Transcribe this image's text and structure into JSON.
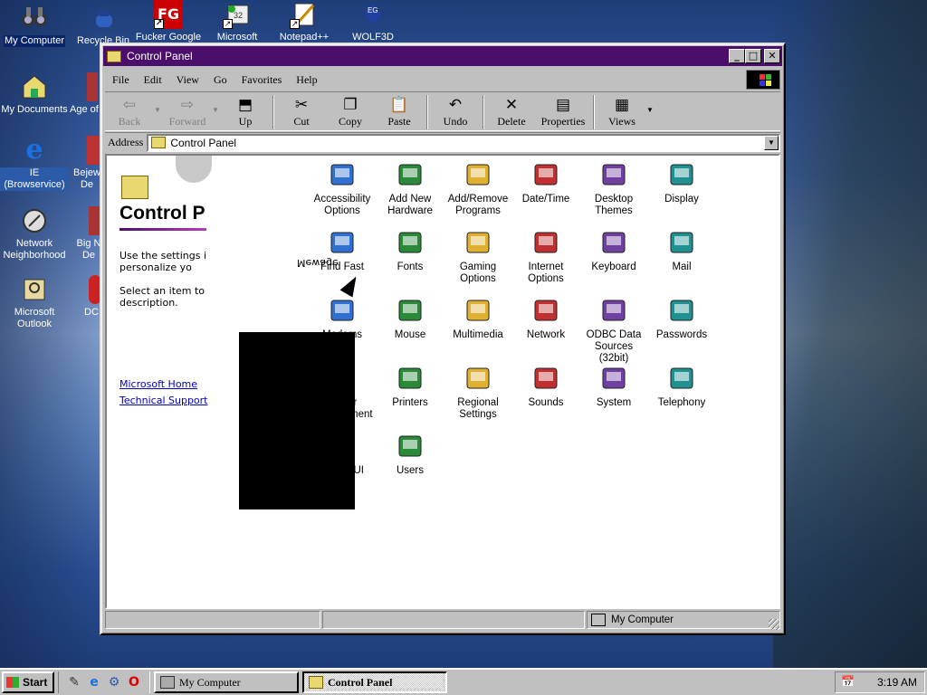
{
  "desktop": {
    "icons": [
      {
        "label": "My Computer",
        "icon": "my-computer-icon"
      },
      {
        "label": "Recycle Bin",
        "icon": "recycle-bin-icon"
      },
      {
        "label": "Fucker Google",
        "icon": "fg-icon"
      },
      {
        "label": "Microsoft",
        "icon": "microsoft-32-icon"
      },
      {
        "label": "Notepad++",
        "icon": "notepad-plus-icon"
      },
      {
        "label": "WOLF3D",
        "icon": "wolf3d-icon"
      },
      {
        "label": "My Documents",
        "icon": "my-documents-icon"
      },
      {
        "label": "Age of",
        "icon": "age-of-icon"
      },
      {
        "label": "IE (Browservice)",
        "icon": "internet-explorer-icon"
      },
      {
        "label": "Bejew De",
        "icon": "bejeweled-icon"
      },
      {
        "label": "Network Neighborhood",
        "icon": "network-neighborhood-icon"
      },
      {
        "label": "Big N De",
        "icon": "big-n-icon"
      },
      {
        "label": "Microsoft Outlook",
        "icon": "outlook-icon"
      },
      {
        "label": "DC",
        "icon": "dc-icon"
      }
    ]
  },
  "window": {
    "title": "Control Panel",
    "menu": [
      "File",
      "Edit",
      "View",
      "Go",
      "Favorites",
      "Help"
    ],
    "toolbar": {
      "back": "Back",
      "forward": "Forward",
      "up": "Up",
      "cut": "Cut",
      "copy": "Copy",
      "paste": "Paste",
      "undo": "Undo",
      "delete": "Delete",
      "properties": "Properties",
      "views": "Views"
    },
    "address": {
      "label": "Address",
      "value": "Control Panel"
    },
    "leftpane": {
      "heading": "Control P",
      "desc1": "Use the settings in Control Panel to personalize yo",
      "desc2": "Select an item to view its description.",
      "link1": "Microsoft Home",
      "link2": "Technical Support",
      "mirror_text": "Mewage"
    },
    "items": [
      {
        "label": "Accessibility Options",
        "icon": "accessibility-icon"
      },
      {
        "label": "Add New Hardware",
        "icon": "add-hardware-icon"
      },
      {
        "label": "Add/Remove Programs",
        "icon": "add-remove-programs-icon"
      },
      {
        "label": "Date/Time",
        "icon": "date-time-icon"
      },
      {
        "label": "Desktop Themes",
        "icon": "desktop-themes-icon"
      },
      {
        "label": "Display",
        "icon": "display-icon"
      },
      {
        "label": "Find Fast",
        "icon": "find-fast-icon"
      },
      {
        "label": "Fonts",
        "icon": "fonts-icon"
      },
      {
        "label": "Gaming Options",
        "icon": "gaming-options-icon"
      },
      {
        "label": "Internet Options",
        "icon": "internet-options-icon"
      },
      {
        "label": "Keyboard",
        "icon": "keyboard-icon"
      },
      {
        "label": "Mail",
        "icon": "mail-icon"
      },
      {
        "label": "Modems",
        "icon": "modems-icon"
      },
      {
        "label": "Mouse",
        "icon": "mouse-icon"
      },
      {
        "label": "Multimedia",
        "icon": "multimedia-icon"
      },
      {
        "label": "Network",
        "icon": "network-icon"
      },
      {
        "label": "ODBC Data Sources (32bit)",
        "icon": "odbc-icon"
      },
      {
        "label": "Passwords",
        "icon": "passwords-icon"
      },
      {
        "label": "Power Management",
        "icon": "power-management-icon"
      },
      {
        "label": "Printers",
        "icon": "printers-icon"
      },
      {
        "label": "Regional Settings",
        "icon": "regional-settings-icon"
      },
      {
        "label": "Sounds",
        "icon": "sounds-icon"
      },
      {
        "label": "System",
        "icon": "system-icon"
      },
      {
        "label": "Telephony",
        "icon": "telephony-icon"
      },
      {
        "label": "Tweak UI",
        "icon": "tweak-ui-icon"
      },
      {
        "label": "Users",
        "icon": "users-icon"
      }
    ],
    "status": {
      "right": "My Computer"
    }
  },
  "taskbar": {
    "start": "Start",
    "tasks": [
      "My Computer",
      "Control Panel"
    ],
    "clock": "3:19 AM"
  }
}
